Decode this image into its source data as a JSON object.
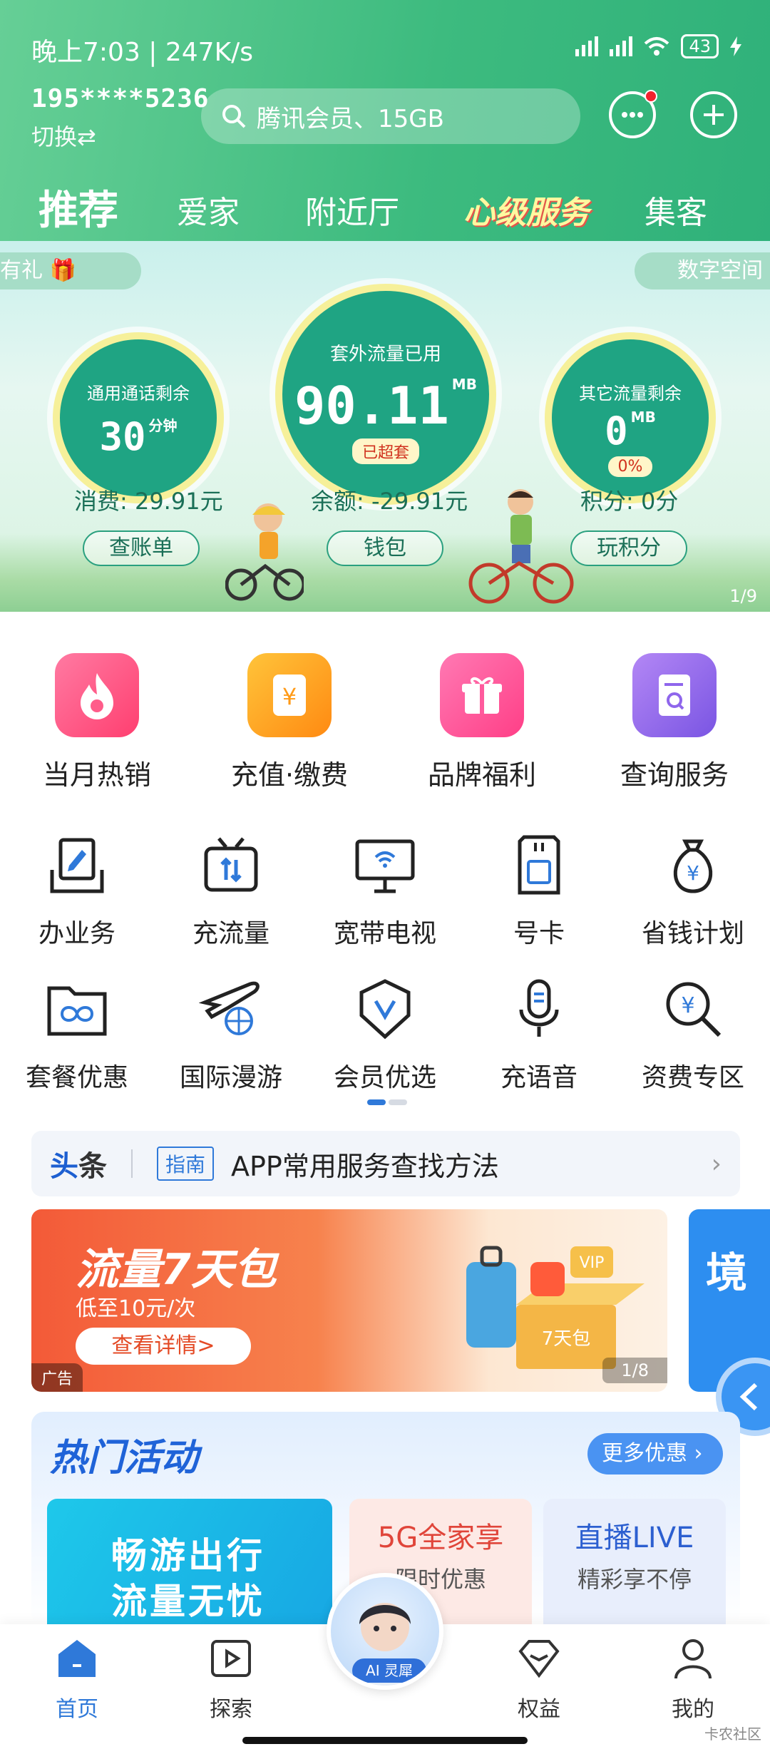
{
  "status": {
    "time": "晚上7:03 | 247K/s",
    "battery": "43"
  },
  "account": {
    "number": "195****5236",
    "switch_label": "切换⇄"
  },
  "search": {
    "placeholder": "腾讯会员、15GB"
  },
  "top_tabs": [
    "推荐",
    "爱家",
    "附近厅",
    "心级服务",
    "集客"
  ],
  "banner": {
    "left_pill": "有礼",
    "right_pill": "数字空间",
    "gauges": [
      {
        "label": "通用通话剩余",
        "value": "30",
        "unit": "分钟",
        "tag": ""
      },
      {
        "label": "套外流量已用",
        "value": "90.11",
        "unit": "MB",
        "tag": "已超套"
      },
      {
        "label": "其它流量剩余",
        "value": "0",
        "unit": "MB",
        "tag": "0%"
      }
    ],
    "stats": [
      "消费: 29.91元",
      "余额: -29.91元",
      "积分: 0分"
    ],
    "buttons": [
      "查账单",
      "钱包",
      "玩积分"
    ],
    "page_indicator": "1/9"
  },
  "big_menu": [
    {
      "label": "当月热销",
      "icon": "flame-icon",
      "color": "#ff4f87"
    },
    {
      "label": "充值·缴费",
      "icon": "yuan-icon",
      "color": "#ffa11b"
    },
    {
      "label": "品牌福利",
      "icon": "gift-icon",
      "color": "#ff4f9c"
    },
    {
      "label": "查询服务",
      "icon": "search-doc-icon",
      "color": "#8f66ec"
    }
  ],
  "small_menu": [
    {
      "label": "办业务",
      "icon": "form-edit-icon"
    },
    {
      "label": "充流量",
      "icon": "data-transfer-icon"
    },
    {
      "label": "宽带电视",
      "icon": "tv-wifi-icon"
    },
    {
      "label": "号卡",
      "icon": "sim-card-icon"
    },
    {
      "label": "省钱计划",
      "icon": "money-bag-icon"
    },
    {
      "label": "套餐优惠",
      "icon": "folder-infinity-icon"
    },
    {
      "label": "国际漫游",
      "icon": "plane-globe-icon"
    },
    {
      "label": "会员优选",
      "icon": "vip-badge-icon"
    },
    {
      "label": "充语音",
      "icon": "microphone-icon"
    },
    {
      "label": "资费专区",
      "icon": "yuan-search-icon"
    }
  ],
  "headline": {
    "tag_a": "头",
    "tag_b": "条",
    "badge": "指南",
    "text": "APP常用服务查找方法"
  },
  "ad": {
    "title": "流量7天包",
    "subtitle": "低至10元/次",
    "button": "查看详情>",
    "tag": "广告",
    "page": "1/8",
    "next_preview": "境"
  },
  "hot": {
    "title": "热门活动",
    "more": "更多优惠",
    "card1": [
      "畅游出行",
      "流量无忧"
    ],
    "card2": {
      "title": "5G全家享",
      "sub": "限时优惠"
    },
    "card3": {
      "title": "直播LIVE",
      "sub": "精彩享不停"
    }
  },
  "bottom_nav": [
    {
      "label": "首页"
    },
    {
      "label": "探索"
    },
    {
      "label": "权益"
    },
    {
      "label": "我的"
    }
  ],
  "ai_badge": "AI 灵犀",
  "watermark": "卡农社区",
  "colors": {
    "header_green": "#3dbb7f",
    "accent_blue": "#2f79d9",
    "gauge_green": "#1fa483"
  }
}
